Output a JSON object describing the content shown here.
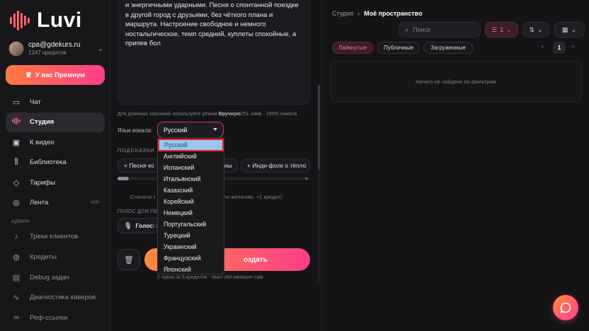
{
  "brand": {
    "name": "Luvi"
  },
  "account": {
    "email": "cpa@gdekurs.ru",
    "credits": "1247 кредитов"
  },
  "premium_button": "У вас Премиум",
  "nav": [
    {
      "label": "Чат",
      "icon": "chat-icon"
    },
    {
      "label": "Студия",
      "icon": "waveform-icon",
      "active": true
    },
    {
      "label": "К видео",
      "icon": "video-icon"
    },
    {
      "label": "Библиотека",
      "icon": "library-icon"
    },
    {
      "label": "Тарифы",
      "icon": "diamond-icon"
    },
    {
      "label": "Лента",
      "icon": "compass-icon",
      "badge": "WIP"
    }
  ],
  "admin_label": "АДМИН",
  "admin_nav": [
    {
      "label": "Треки клиентов",
      "icon": "music-note-icon"
    },
    {
      "label": "Кредиты",
      "icon": "coins-icon"
    },
    {
      "label": "Debug задач",
      "icon": "debug-icon"
    },
    {
      "label": "Диагностика каверов",
      "icon": "pulse-icon"
    },
    {
      "label": "Реф-ссылки",
      "icon": "link-icon"
    }
  ],
  "composer": {
    "text": "и энергичными ударными. Песня о спонтанной поездке в другой город с друзьями, без чёткого плана и маршрута. Настроение свободное и немного ностальгическое, темп средний, куплеты спокойные, а припев бол",
    "hint_prefix": "Для длинных описаний используйте режим ",
    "hint_mode": "Вручную",
    "hint_suffix": "251 симв · 100% лимита",
    "language_label": "Язык вокала:",
    "language_value": "Русский",
    "suggestions_label": "ПОДСКАЗКИ",
    "chips": [
      "+ Песня ко",
      "ны",
      "+ Инди-фолк о тёпло"
    ],
    "optional_note": "Сначала с",
    "optional_note_tail": "ст (по желанию, +1 кредит)",
    "voice_label": "ГОЛОС ДЛЯ ПЕ",
    "voice_button": "Голос: по",
    "create_button": "Создать",
    "create_visible": "оздать",
    "cost_note": "2 трека за 5 кредитов · текст ИИ напишет сам"
  },
  "language_options": [
    "Русский",
    "Английский",
    "Испанский",
    "Итальянский",
    "Казахский",
    "Корейский",
    "Немецкий",
    "Португальский",
    "Турецкий",
    "Украинский",
    "Французский",
    "Японский"
  ],
  "selected_language": "Русский",
  "library": {
    "breadcrumb_root": "Студия",
    "breadcrumb_current": "Моё пространство",
    "search_placeholder": "Поиск",
    "filter_count": "1",
    "tabs": [
      "Лайкнутые",
      "Публичные",
      "Загруженные"
    ],
    "active_tab": "Лайкнутые",
    "page": "1",
    "empty_text": "Ничего не найдено по фильтрам"
  },
  "colors": {
    "accent": "#ff3d8b",
    "accent_orange": "#ff8a3d",
    "bg": "#141416",
    "sidebar": "#17171a"
  }
}
